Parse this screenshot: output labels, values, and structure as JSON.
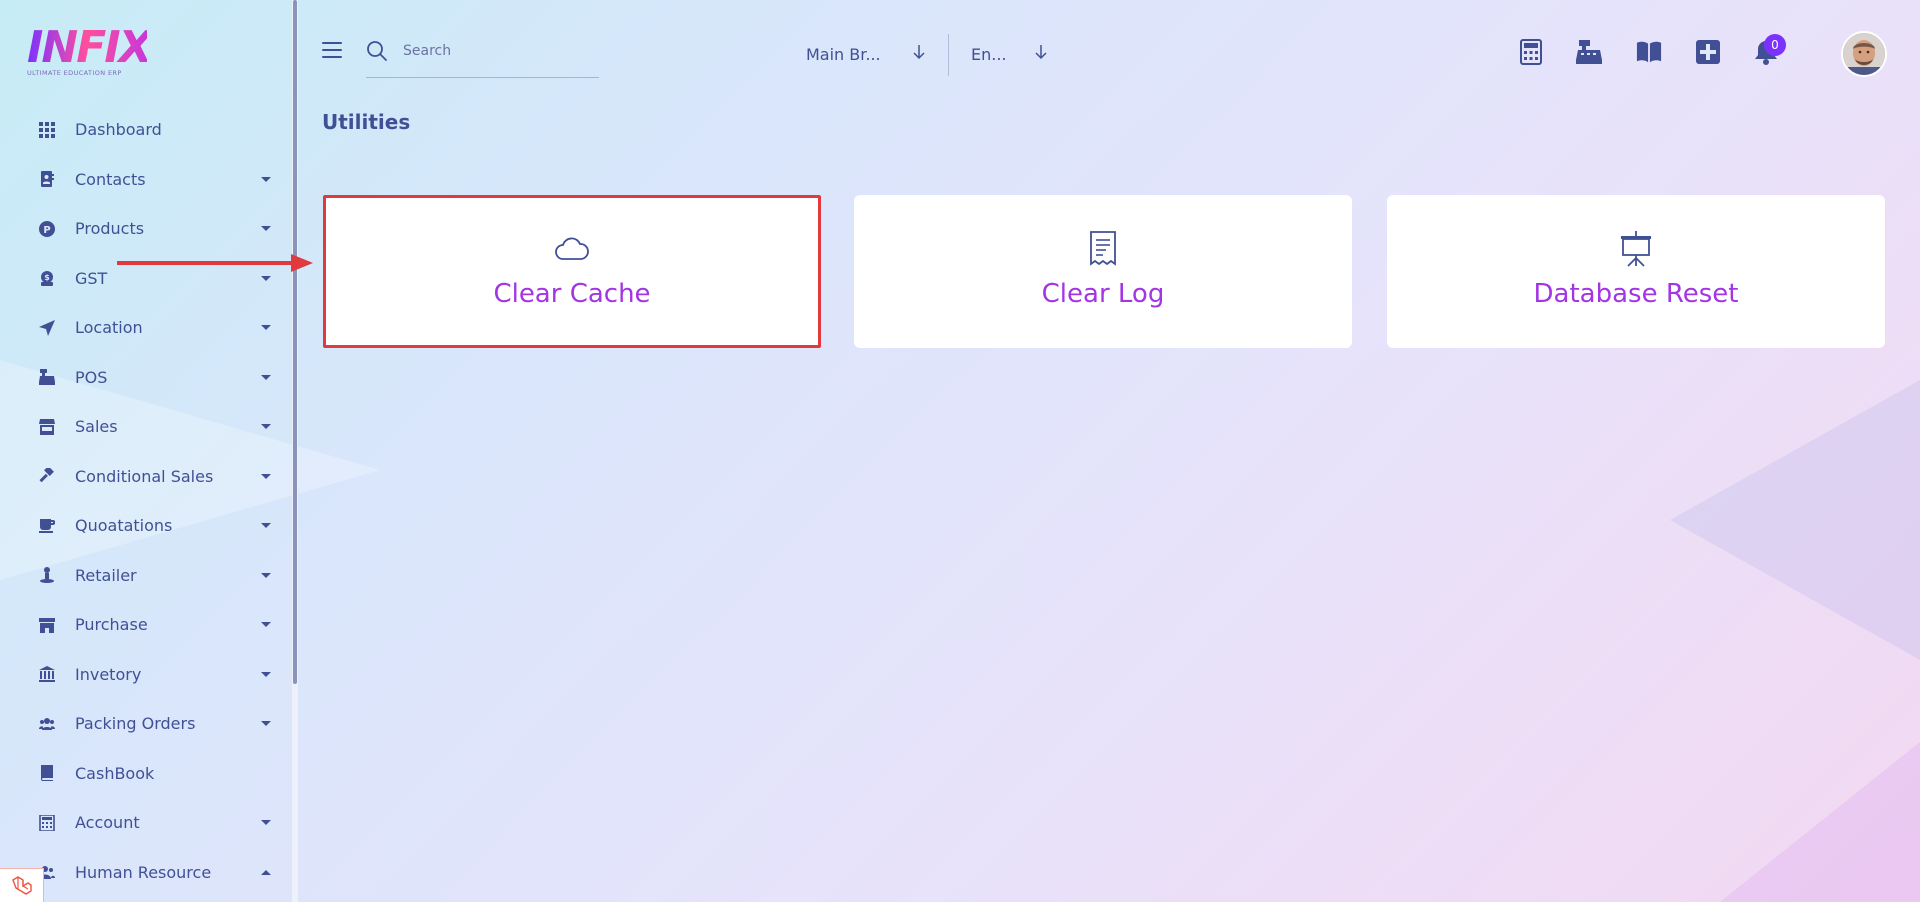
{
  "app": {
    "logo_text": "INFIX",
    "logo_subtitle": "ULTIMATE EDUCATION ERP",
    "accent_color": "#7c32ff",
    "label_color": "#a335e4",
    "text_color": "#415094"
  },
  "sidebar": {
    "items": [
      {
        "label": "Dashboard",
        "icon": "grid-icon",
        "has_caret": false
      },
      {
        "label": "Contacts",
        "icon": "contact-book-icon",
        "has_caret": true
      },
      {
        "label": "Products",
        "icon": "product-circle-icon",
        "has_caret": true
      },
      {
        "label": "GST",
        "icon": "money-bag-icon",
        "has_caret": true
      },
      {
        "label": "Location",
        "icon": "location-arrow-icon",
        "has_caret": true
      },
      {
        "label": "POS",
        "icon": "cash-register-icon",
        "has_caret": true
      },
      {
        "label": "Sales",
        "icon": "store-icon",
        "has_caret": true
      },
      {
        "label": "Conditional Sales",
        "icon": "gavel-icon",
        "has_caret": true
      },
      {
        "label": "Quoatations",
        "icon": "mug-icon",
        "has_caret": true
      },
      {
        "label": "Retailer",
        "icon": "person-pin-icon",
        "has_caret": true
      },
      {
        "label": "Purchase",
        "icon": "shop-icon",
        "has_caret": true
      },
      {
        "label": "Invetory",
        "icon": "bank-icon",
        "has_caret": true
      },
      {
        "label": "Packing Orders",
        "icon": "users-icon",
        "has_caret": true
      },
      {
        "label": "CashBook",
        "icon": "book-icon",
        "has_caret": false
      },
      {
        "label": "Account",
        "icon": "calculator-icon",
        "has_caret": true
      },
      {
        "label": "Human Resource",
        "icon": "user-group-icon",
        "has_caret": true,
        "expanded": true
      }
    ]
  },
  "header": {
    "search_placeholder": "Search",
    "branch_select": "Main Br...",
    "language_select": "En...",
    "notification_count": "0",
    "icons": [
      "calculator-icon",
      "cash-register-icon",
      "book-open-icon",
      "plus-square-icon",
      "bell-icon"
    ]
  },
  "main": {
    "page_title": "Utilities",
    "cards": [
      {
        "label": "Clear Cache",
        "icon": "cloud-icon",
        "highlighted": true
      },
      {
        "label": "Clear Log",
        "icon": "receipt-icon",
        "highlighted": false
      },
      {
        "label": "Database Reset",
        "icon": "presentation-board-icon",
        "highlighted": false
      }
    ]
  }
}
